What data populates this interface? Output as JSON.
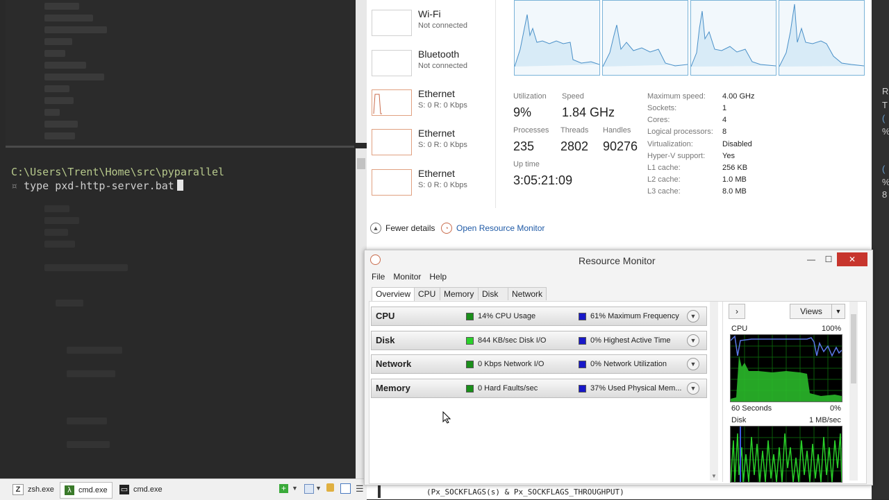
{
  "terminal": {
    "prompt_path": "C:\\Users\\Trent\\Home\\src\\pyparallel",
    "command_marker": "¤",
    "command": "type pxd-http-server.bat"
  },
  "taskbar": {
    "tabs": [
      {
        "label": "zsh.exe",
        "icon": "z-icon"
      },
      {
        "label": "cmd.exe",
        "icon": "lambda-icon"
      },
      {
        "label": "cmd.exe",
        "icon": "console-icon"
      }
    ]
  },
  "task_manager": {
    "network_list": [
      {
        "name": "Wi-Fi",
        "status": "Not connected"
      },
      {
        "name": "Bluetooth",
        "status": "Not connected"
      },
      {
        "name": "Ethernet",
        "status": "S: 0 R: 0 Kbps"
      },
      {
        "name": "Ethernet",
        "status": "S: 0 R: 0 Kbps"
      },
      {
        "name": "Ethernet",
        "status": "S: 0 R: 0 Kbps"
      }
    ],
    "stats": {
      "utilization_label": "Utilization",
      "utilization": "9%",
      "speed_label": "Speed",
      "speed": "1.84 GHz",
      "processes_label": "Processes",
      "processes": "235",
      "threads_label": "Threads",
      "threads": "2802",
      "handles_label": "Handles",
      "handles": "90276",
      "uptime_label": "Up time",
      "uptime": "3:05:21:09"
    },
    "specs": [
      {
        "key": "Maximum speed:",
        "value": "4.00 GHz"
      },
      {
        "key": "Sockets:",
        "value": "1"
      },
      {
        "key": "Cores:",
        "value": "4"
      },
      {
        "key": "Logical processors:",
        "value": "8"
      },
      {
        "key": "Virtualization:",
        "value": "Disabled"
      },
      {
        "key": "Hyper-V support:",
        "value": "Yes"
      },
      {
        "key": "L1 cache:",
        "value": "256 KB"
      },
      {
        "key": "L2 cache:",
        "value": "1.0 MB"
      },
      {
        "key": "L3 cache:",
        "value": "8.0 MB"
      }
    ],
    "fewer_details": "Fewer details",
    "open_resource_monitor": "Open Resource Monitor"
  },
  "resource_monitor": {
    "title": "Resource Monitor",
    "menu": [
      "File",
      "Monitor",
      "Help"
    ],
    "tabs": [
      "Overview",
      "CPU",
      "Memory",
      "Disk",
      "Network"
    ],
    "sections": [
      {
        "name": "CPU",
        "metric_a": "14% CPU Usage",
        "metric_b": "61% Maximum Frequency"
      },
      {
        "name": "Disk",
        "metric_a": "844 KB/sec Disk I/O",
        "metric_b": "0% Highest Active Time"
      },
      {
        "name": "Network",
        "metric_a": "0 Kbps Network I/O",
        "metric_b": "0% Network Utilization"
      },
      {
        "name": "Memory",
        "metric_a": "0 Hard Faults/sec",
        "metric_b": "37% Used Physical Mem..."
      }
    ],
    "side": {
      "views_label": "Views",
      "cpu_label": "CPU",
      "cpu_max": "100%",
      "cpu_time": "60 Seconds",
      "cpu_min": "0%",
      "disk_label": "Disk",
      "disk_max": "1 MB/sec"
    }
  },
  "right_strip": [
    "R",
    "T",
    "(",
    "%",
    "(",
    "%",
    "8"
  ],
  "code_snippet": "(Px_SOCKFLAGS(s) & Px_SOCKFLAGS_THROUGHPUT)",
  "colors": {
    "green": "#1a8f1a",
    "bright_green": "#2ad12a",
    "blue": "#1818c8",
    "close_red": "#c7352d",
    "graph_blue": "#7ab3d8"
  }
}
